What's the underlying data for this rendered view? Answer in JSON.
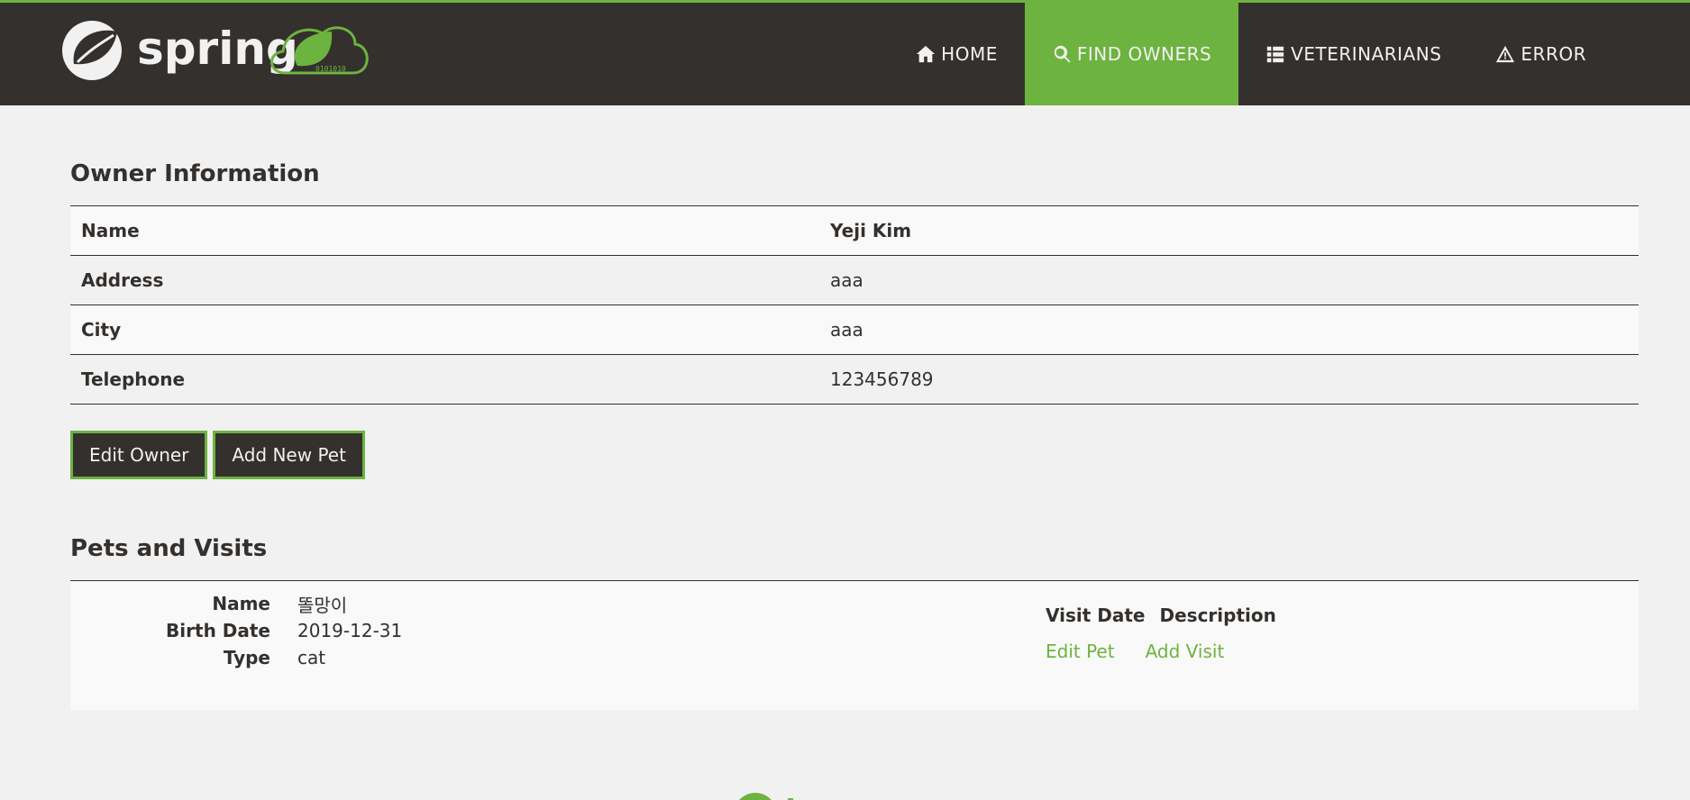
{
  "header": {
    "brand": "spring",
    "logo_code": "0101010",
    "nav": [
      {
        "label": "HOME",
        "icon": "home-icon"
      },
      {
        "label": "FIND OWNERS",
        "icon": "search-icon",
        "active": true
      },
      {
        "label": "VETERINARIANS",
        "icon": "list-icon"
      },
      {
        "label": "ERROR",
        "icon": "warning-icon"
      }
    ]
  },
  "owner": {
    "heading": "Owner Information",
    "rows": [
      {
        "label": "Name",
        "value": "Yeji Kim"
      },
      {
        "label": "Address",
        "value": "aaa"
      },
      {
        "label": "City",
        "value": "aaa"
      },
      {
        "label": "Telephone",
        "value": "123456789"
      }
    ],
    "edit_label": "Edit Owner",
    "add_pet_label": "Add New Pet"
  },
  "pets": {
    "heading": "Pets and Visits",
    "items": [
      {
        "name_label": "Name",
        "name": "똘망이",
        "birth_label": "Birth Date",
        "birth": "2019-12-31",
        "type_label": "Type",
        "type": "cat",
        "visit_date_label": "Visit Date",
        "description_label": "Description",
        "edit_pet_label": "Edit Pet",
        "add_visit_label": "Add Visit"
      }
    ]
  },
  "colors": {
    "brand_green": "#6db33f",
    "dark": "#34302d",
    "background": "#f1f1f1"
  }
}
